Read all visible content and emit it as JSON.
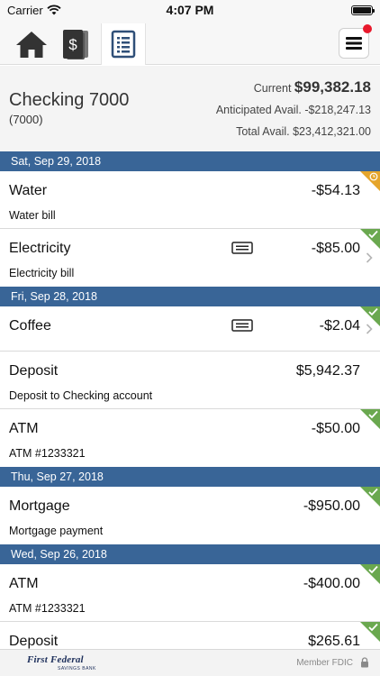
{
  "status_bar": {
    "carrier": "Carrier",
    "time": "4:07 PM"
  },
  "nav": {
    "tabs": [
      {
        "icon": "home-icon",
        "active": false
      },
      {
        "icon": "money-icon",
        "active": false
      },
      {
        "icon": "register-icon",
        "active": true
      }
    ],
    "menu_icon": "hamburger-icon"
  },
  "account": {
    "name": "Checking 7000",
    "number": "(7000)",
    "current_label": "Current",
    "current_amount": "$99,382.18",
    "anticipated_label": "Anticipated Avail.",
    "anticipated_amount": "-$218,247.13",
    "total_label": "Total Avail.",
    "total_amount": "$23,412,321.00"
  },
  "groups": [
    {
      "date": "Sat, Sep 29, 2018",
      "transactions": [
        {
          "name": "Water",
          "description": "Water bill",
          "amount": "-$54.13",
          "status": "pending"
        },
        {
          "name": "Electricity",
          "description": "Electricity bill",
          "amount": "-$85.00",
          "status": "cleared",
          "memo": true,
          "chevron": true
        }
      ]
    },
    {
      "date": "Fri, Sep 28, 2018",
      "transactions": [
        {
          "name": "Coffee",
          "description": "",
          "amount": "-$2.04",
          "status": "cleared",
          "memo": true,
          "chevron": true
        },
        {
          "name": "Deposit",
          "description": "Deposit to Checking account",
          "amount": "$5,942.37",
          "status": "cleared"
        },
        {
          "name": "ATM",
          "description": "ATM #1233321",
          "amount": "-$50.00",
          "status": "cleared"
        }
      ]
    },
    {
      "date": "Thu, Sep 27, 2018",
      "transactions": [
        {
          "name": "Mortgage",
          "description": "Mortgage payment",
          "amount": "-$950.00",
          "status": "cleared"
        }
      ]
    },
    {
      "date": "Wed, Sep 26, 2018",
      "transactions": [
        {
          "name": "ATM",
          "description": "ATM #1233321",
          "amount": "-$400.00",
          "status": "cleared"
        },
        {
          "name": "Deposit",
          "description": "",
          "amount": "$265.61",
          "status": "cleared"
        }
      ]
    }
  ],
  "footer": {
    "logo": "First Federal",
    "logo_sub": "SAVINGS BANK",
    "fdic": "Member FDIC"
  },
  "colors": {
    "date_header": "#396597",
    "cleared": "#6aa84f",
    "pending": "#e5a52b",
    "alert_dot": "#e8192c"
  }
}
